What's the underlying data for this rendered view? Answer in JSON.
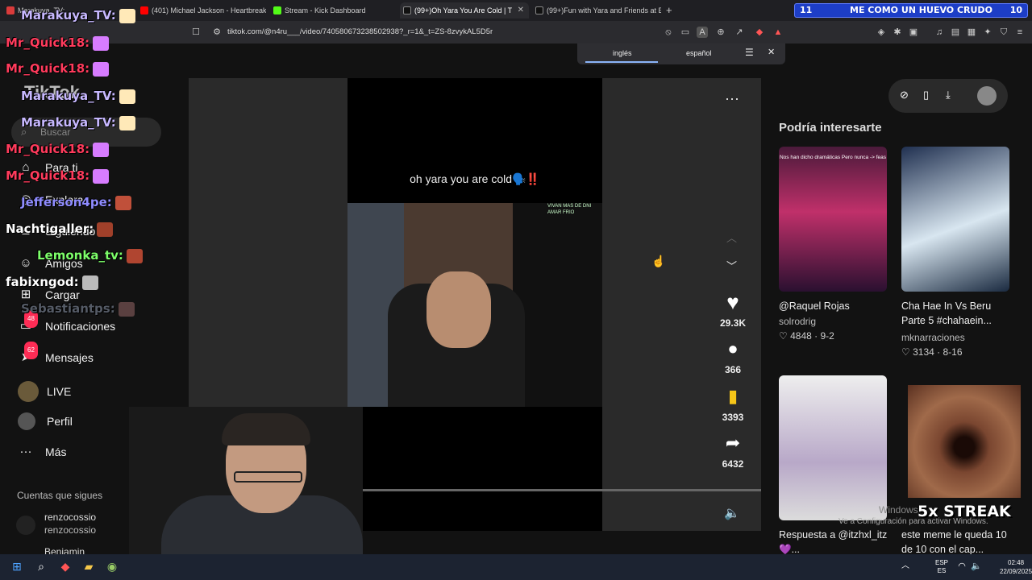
{
  "browser": {
    "tabs": [
      {
        "label": "Marakuya_TV:",
        "active": false
      },
      {
        "label": "(401) Michael Jackson - Heartbreak H",
        "active": false
      },
      {
        "label": "Stream - Kick Dashboard",
        "active": false
      },
      {
        "label": "(99+)Oh Yara You Are Cold | T",
        "active": true
      },
      {
        "label": "(99+)Fun with Yara and Friends at E",
        "active": false
      }
    ],
    "url": "tiktok.com/@n4ru___/video/740580673238502938?_r=1&_t=ZS-8zvykAL5D5r",
    "overlay_left_num": "11",
    "overlay_title": "ME COMO UN HUEVO CRUDO",
    "overlay_right_num": "10"
  },
  "translate": {
    "lang_from": "inglés",
    "lang_to": "español"
  },
  "sidebar": {
    "search_placeholder": "Buscar",
    "items": [
      {
        "label": "Para ti",
        "icon": "home-icon"
      },
      {
        "label": "Explorar",
        "icon": "compass-icon"
      },
      {
        "label": "Siguiendo",
        "icon": "people-icon"
      },
      {
        "label": "Amigos",
        "icon": "friends-icon"
      },
      {
        "label": "Cargar",
        "icon": "plus-square-icon"
      },
      {
        "label": "Notificaciones",
        "icon": "inbox-icon",
        "badge": "48"
      },
      {
        "label": "Mensajes",
        "icon": "send-icon",
        "badge": "62"
      },
      {
        "label": "LIVE",
        "icon": "live-icon"
      },
      {
        "label": "Perfil",
        "icon": "avatar-icon"
      },
      {
        "label": "Más",
        "icon": "more-icon"
      }
    ],
    "following_title": "Cuentas que sigues",
    "following": [
      {
        "name": "renzocossio",
        "handle": "renzocossio"
      },
      {
        "name": "Benjamin",
        "handle": ""
      }
    ]
  },
  "video": {
    "caption": "oh yara you are cold🗣️‼️",
    "chat_header": "VIVAN MAS DE DNI AMAR FRIO",
    "likes": "29.3K",
    "comments": "366",
    "saves": "3393",
    "shares": "6432"
  },
  "recs": {
    "title": "Podría interesarte",
    "cards": [
      {
        "title": "@Raquel Rojas",
        "author": "solrodrig",
        "likes": "4848",
        "date": "9-2",
        "thumb_text": "Nos han dicho dramáticas Pero nunca -> feas"
      },
      {
        "title": "Cha Hae In Vs Beru Parte 5 #chahaein...",
        "author": "mknarraciones",
        "likes": "3134",
        "date": "8-16",
        "thumb_text": ""
      },
      {
        "title": "Respuesta a @itzhxl_itz 💜...",
        "author": "",
        "likes": "",
        "date": "",
        "thumb_text": ""
      },
      {
        "title": "este meme le queda 10 de 10 con el cap...",
        "author": "",
        "likes": "",
        "date": "",
        "thumb_text": ""
      }
    ]
  },
  "chat_overlay": [
    {
      "user": "Marakuya_TV:",
      "color": "#c7b8ff"
    },
    {
      "user": "Mr_Quick18:",
      "color": "#ff3b5c"
    },
    {
      "user": "Mr_Quick18:",
      "color": "#ff3b5c"
    },
    {
      "user": "Marakuya_TV:",
      "color": "#c7b8ff"
    },
    {
      "user": "Marakuya_TV:",
      "color": "#c7b8ff"
    },
    {
      "user": "Mr_Quick18:",
      "color": "#ff3b5c"
    },
    {
      "user": "Mr_Quick18:",
      "color": "#ff3b5c"
    },
    {
      "user": "Jefferson4pe:",
      "color": "#8f8cff"
    },
    {
      "user": "Nachtigaller:",
      "color": "#ffffff"
    },
    {
      "user": "Lemonka_tv:",
      "color": "#7dff6a"
    },
    {
      "user": "fabixngod:",
      "color": "#ffffff"
    },
    {
      "user": "Sebastiantps:",
      "color": "#555b66"
    }
  ],
  "overlays": {
    "streak": "5x STREAK",
    "windows_activate": "Ve a Configuración para activar Windows.",
    "windows_word": "Windows"
  },
  "taskbar": {
    "time": "02:48",
    "date": "22/09/2025",
    "lang1": "ESP",
    "lang2": "ES"
  }
}
